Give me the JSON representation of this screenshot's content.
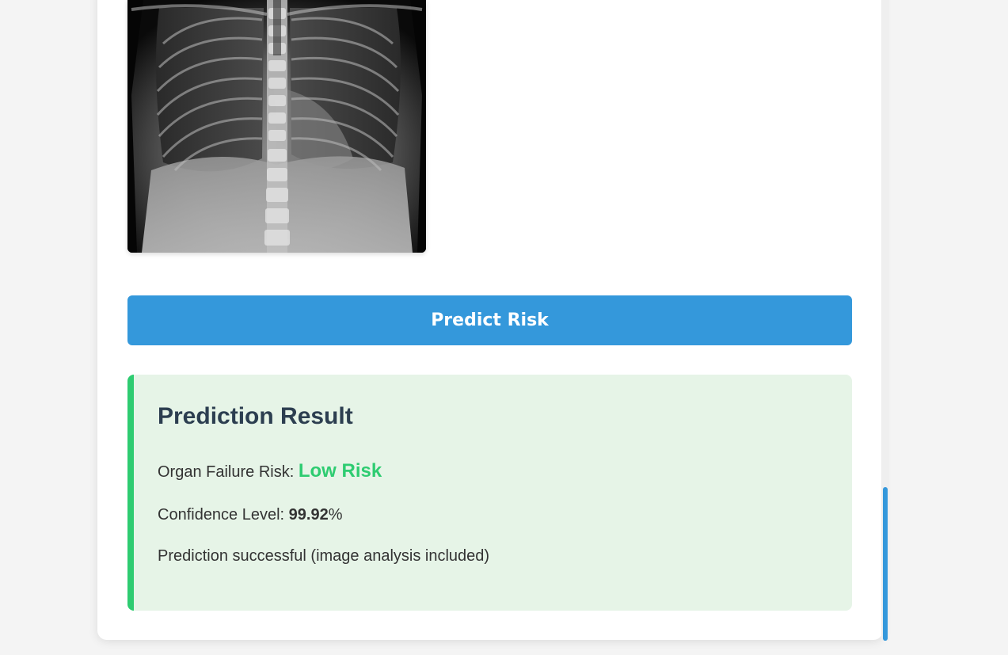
{
  "image_preview": {
    "alt": "Chest X-ray"
  },
  "actions": {
    "predict_label": "Predict Risk"
  },
  "result": {
    "title": "Prediction Result",
    "risk_label": "Organ Failure Risk:",
    "risk_value": "Low Risk",
    "confidence_label": "Confidence Level:",
    "confidence_value": "99.92",
    "confidence_unit": "%",
    "message": "Prediction successful (image analysis included)"
  },
  "colors": {
    "accent": "#3498db",
    "success": "#2ecc71",
    "result_background": "#e6f4e7",
    "title": "#2c3e50"
  },
  "scroll": {
    "position": 1.0
  }
}
